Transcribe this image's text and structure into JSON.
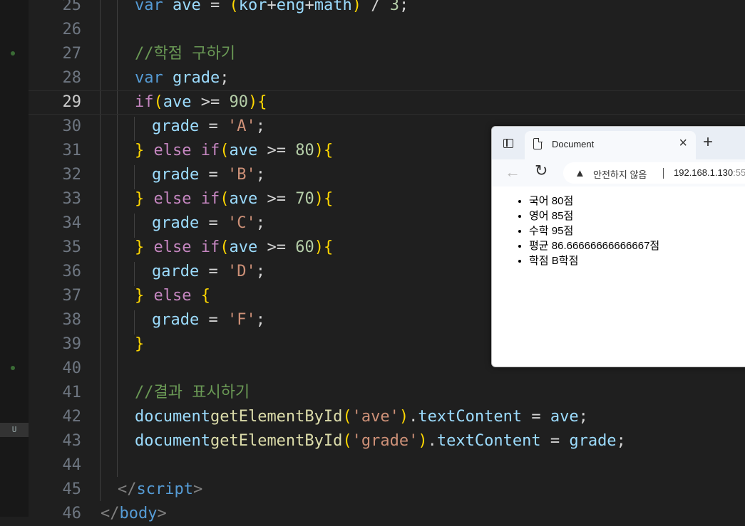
{
  "editor": {
    "lines": [
      {
        "n": "25"
      },
      {
        "n": "26"
      },
      {
        "n": "27"
      },
      {
        "n": "28"
      },
      {
        "n": "29"
      },
      {
        "n": "30"
      },
      {
        "n": "31"
      },
      {
        "n": "32"
      },
      {
        "n": "33"
      },
      {
        "n": "34"
      },
      {
        "n": "35"
      },
      {
        "n": "36"
      },
      {
        "n": "37"
      },
      {
        "n": "38"
      },
      {
        "n": "39"
      },
      {
        "n": "40"
      },
      {
        "n": "41"
      },
      {
        "n": "42"
      },
      {
        "n": "43"
      },
      {
        "n": "44"
      },
      {
        "n": "45"
      },
      {
        "n": "46"
      }
    ],
    "code": {
      "l25": {
        "kw": "var",
        "v": "ave",
        "op": " = ",
        "p1": "(",
        "a": "kor",
        "plus1": "+",
        "b": "eng",
        "plus2": "+",
        "c": "math",
        "p2": ")",
        "tail": " / ",
        "num": "3",
        ";": ";"
      },
      "l27": "//학점 구하기",
      "l28": {
        "kw": "var",
        "v": "grade",
        ";": ";"
      },
      "l29": {
        "if": "if",
        "p1": "(",
        "v": "ave",
        "op": " >= ",
        "num": "90",
        "p2": ")",
        "b": "{"
      },
      "l30": {
        "v": "grade",
        "op": " = ",
        "s": "'A'",
        ";": ";"
      },
      "l31": {
        "b1": "}",
        "else": " else ",
        "if": "if",
        "p1": "(",
        "v": "ave",
        "op": " >= ",
        "num": "80",
        "p2": ")",
        "b2": "{"
      },
      "l32": {
        "v": "grade",
        "op": " = ",
        "s": "'B'",
        ";": ";"
      },
      "l33": {
        "b1": "}",
        "else": " else ",
        "if": "if",
        "p1": "(",
        "v": "ave",
        "op": " >= ",
        "num": "70",
        "p2": ")",
        "b2": "{"
      },
      "l34": {
        "v": "grade",
        "op": " = ",
        "s": "'C'",
        ";": ";"
      },
      "l35": {
        "b1": "}",
        "else": " else ",
        "if": "if",
        "p1": "(",
        "v": "ave",
        "op": " >= ",
        "num": "60",
        "p2": ")",
        "b2": "{"
      },
      "l36": {
        "v": "garde",
        "op": " = ",
        "s": "'D'",
        ";": ";"
      },
      "l37": {
        "b1": "}",
        "else": " else ",
        "b2": "{"
      },
      "l38": {
        "v": "grade",
        "op": " = ",
        "s": "'F'",
        ";": ";"
      },
      "l39": {
        "b": "}"
      },
      "l41": "//결과 표시하기",
      "l42": {
        "doc": "document",
        ".": ".",
        "fn": "getElementById",
        "p1": "(",
        "s": "'ave'",
        "p2": ")",
        "dot2": ".",
        "prop": "textContent",
        "op": " = ",
        "v": "ave",
        ";": ";"
      },
      "l43": {
        "doc": "document",
        ".": ".",
        "fn": "getElementById",
        "p1": "(",
        "s": "'grade'",
        "p2": ")",
        "dot2": ".",
        "prop": "textContent",
        "op": " = ",
        "v": "grade",
        ";": ";"
      },
      "l45": {
        "open": "</",
        "tag": "script",
        "close": ">"
      },
      "l46": {
        "open": "</",
        "tag": "body",
        "close": ">"
      }
    },
    "badge": "U"
  },
  "browser": {
    "tab_title": "Document",
    "close": "×",
    "newtab": "+",
    "back": "←",
    "reload": "↻",
    "warn_icon": "▲",
    "security_text": "안전하지 않음",
    "url_host": "192.168.1.130",
    "url_port": ":55",
    "items": [
      "국어 80점",
      "영어 85점",
      "수학 95점",
      "평균 86.66666666666667점",
      "학점 B학점"
    ]
  }
}
